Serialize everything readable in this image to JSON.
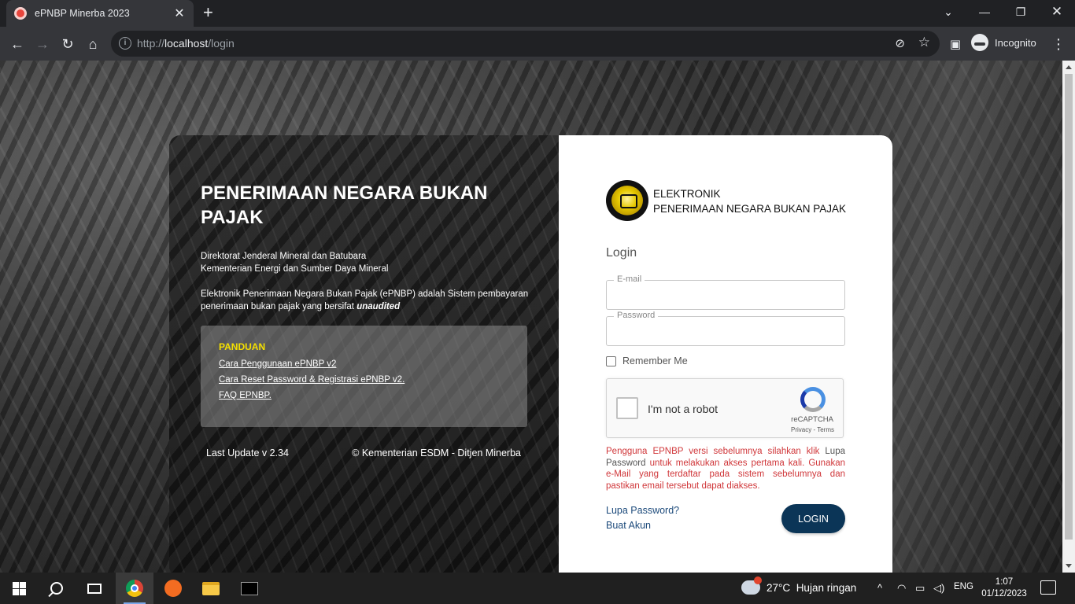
{
  "browser": {
    "tab_title": "ePNBP Minerba 2023",
    "tab_close": "✕",
    "new_tab": "+",
    "url_prefix": "http://",
    "url_host": "localhost",
    "url_path": "/login",
    "profile_label": "Incognito"
  },
  "left": {
    "title": "PENERIMAAN NEGARA BUKAN PAJAK",
    "org_line1": "Direktorat Jenderal Mineral dan Batubara",
    "org_line2": "Kementerian Energi dan Sumber Daya Mineral",
    "desc": "Elektronik Penerimaan Negara Bukan Pajak (ePNBP) adalah Sistem pembayaran penerimaan bukan pajak yang bersifat",
    "desc_emph": "unaudited",
    "panduan_heading": "PANDUAN",
    "panduan_links": [
      "Cara Penggunaan ePNBP v2",
      "Cara Reset Password & Registrasi ePNBP v2.",
      "FAQ EPNBP."
    ],
    "last_update": "Last Update v 2.34",
    "copyright": "© Kementerian ESDM - Ditjen Minerba"
  },
  "right": {
    "brand_line1": "ELEKTRONIK",
    "brand_line2": "PENERIMAAN NEGARA BUKAN PAJAK",
    "login_heading": "Login",
    "email_label": "E-mail",
    "email_value": "",
    "password_label": "Password",
    "password_value": "",
    "remember_label": "Remember Me",
    "captcha_text": "I'm not a robot",
    "captcha_brand": "reCAPTCHA",
    "captcha_links": "Privacy - Terms",
    "notice_part1": "Pengguna EPNBP versi sebelumnya silahkan klik",
    "notice_link": "Lupa Password",
    "notice_part2": "untuk melakukan akses pertama kali. Gunakan e-Mail yang terdaftar pada sistem sebelumnya dan pastikan email tersebut dapat diakses.",
    "forgot_link": "Lupa Password?",
    "create_link": "Buat Akun",
    "login_button": "LOGIN"
  },
  "taskbar": {
    "weather_temp": "27°C",
    "weather_text": "Hujan ringan",
    "weather_badge": "1",
    "language": "ENG",
    "time": "1:07",
    "date": "01/12/2023"
  },
  "colors": {
    "accent_button": "#0b3557",
    "notice_red": "#d0373a",
    "link_blue": "#1c4a7b",
    "panduan_yellow": "#f5e000"
  }
}
